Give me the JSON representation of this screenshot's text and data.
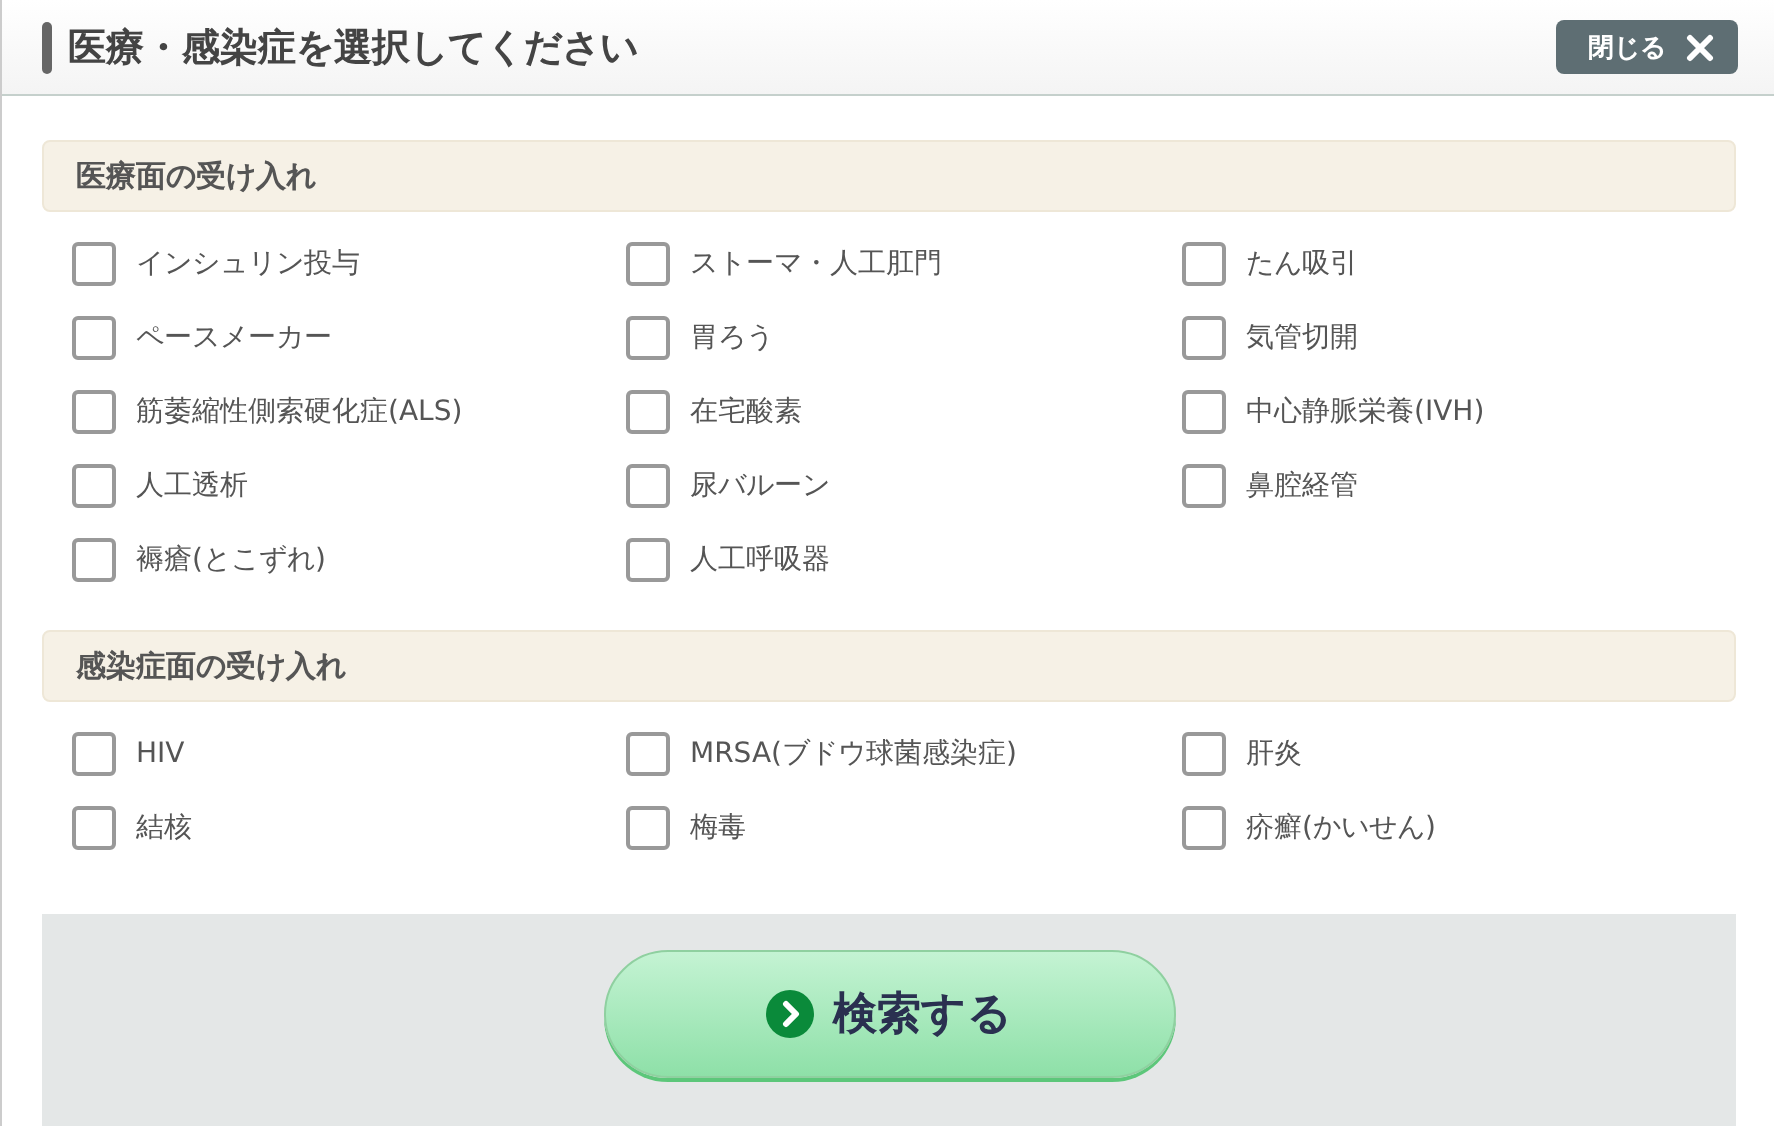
{
  "dialog": {
    "title": "医療・感染症を選択してください",
    "close_button": "閉じる"
  },
  "sections": [
    {
      "heading": "医療面の受け入れ",
      "options": [
        {
          "label": "インシュリン投与",
          "checked": false
        },
        {
          "label": "ストーマ・人工肛門",
          "checked": false
        },
        {
          "label": "たん吸引",
          "checked": false
        },
        {
          "label": "ペースメーカー",
          "checked": false
        },
        {
          "label": "胃ろう",
          "checked": false
        },
        {
          "label": "気管切開",
          "checked": false
        },
        {
          "label": "筋萎縮性側索硬化症(ALS)",
          "checked": false
        },
        {
          "label": "在宅酸素",
          "checked": false
        },
        {
          "label": "中心静脈栄養(IVH)",
          "checked": false
        },
        {
          "label": "人工透析",
          "checked": false
        },
        {
          "label": "尿バルーン",
          "checked": false
        },
        {
          "label": "鼻腔経管",
          "checked": false
        },
        {
          "label": "褥瘡(とこずれ)",
          "checked": false
        },
        {
          "label": "人工呼吸器",
          "checked": false
        }
      ]
    },
    {
      "heading": "感染症面の受け入れ",
      "options": [
        {
          "label": "HIV",
          "checked": false
        },
        {
          "label": "MRSA(ブドウ球菌感染症)",
          "checked": false
        },
        {
          "label": "肝炎",
          "checked": false
        },
        {
          "label": "結核",
          "checked": false
        },
        {
          "label": "梅毒",
          "checked": false
        },
        {
          "label": "疥癬(かいせん)",
          "checked": false
        }
      ]
    }
  ],
  "search_button": "検索する"
}
